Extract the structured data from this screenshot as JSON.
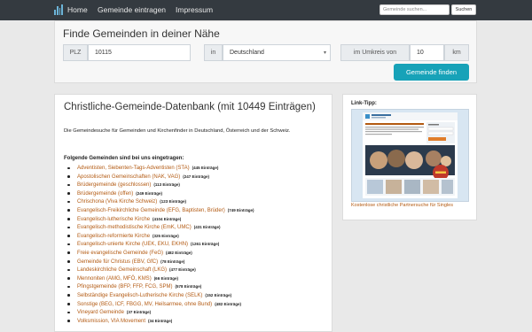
{
  "nav": {
    "home": "Home",
    "add": "Gemeinde eintragen",
    "impressum": "Impressum",
    "search_placeholder": "Gemeinde suchen...",
    "search_button": "Suchen"
  },
  "search": {
    "title": "Finde Gemeinden in deiner Nähe",
    "plz_label": "PLZ",
    "plz_value": "10115",
    "in_label": "in",
    "country_value": "Deutschland",
    "radius_label": "im Umkreis von",
    "radius_value": "10",
    "unit_label": "km",
    "submit_label": "Gemeinde finden"
  },
  "main": {
    "title": "Christliche-Gemeinde-Datenbank (mit 10449 Einträgen)",
    "description": "Die Gemeindesuche für Gemeinden und Kirchenfinder in Deutschland, Österreich und der Schweiz.",
    "list_heading": "Folgende Gemeinden sind bei uns eingetragen:",
    "items": [
      {
        "name": "Adventisten, Siebenten-Tags-Adventisten (STA)",
        "count": "(445 Einträge)"
      },
      {
        "name": "Apostolischen Gemeinschaften (NAK, VAG)",
        "count": "(247 Einträge)"
      },
      {
        "name": "Brüdergemeinde (geschlossen)",
        "count": "(113 Einträge)"
      },
      {
        "name": "Brüdergemeinde (offen)",
        "count": "(249 Einträge)"
      },
      {
        "name": "Chrischona (Viva Kirche Schweiz)",
        "count": "(123 Einträge)"
      },
      {
        "name": "Evangelisch-Freikirchliche Gemeinde (EFG, Baptisten, Brüder)",
        "count": "(749 Einträge)"
      },
      {
        "name": "Evangelisch-lutherische Kirche",
        "count": "(4104 Einträge)"
      },
      {
        "name": "Evangelisch-methodistische Kirche (EmK, UMC)",
        "count": "(431 Einträge)"
      },
      {
        "name": "Evangelisch-reformierte Kirche",
        "count": "(325 Einträge)"
      },
      {
        "name": "Evangelisch-unierte Kirche (UEK, EKU, EKHN)",
        "count": "(1261 Einträge)"
      },
      {
        "name": "Freie evangelische Gemeinde (FeG)",
        "count": "(482 Einträge)"
      },
      {
        "name": "Gemeinde für Christus (EBV, GfC)",
        "count": "(78 Einträge)"
      },
      {
        "name": "Landeskirchliche Gemeinschaft (LKG)",
        "count": "(477 Einträge)"
      },
      {
        "name": "Mennoniten (AMG, MFÖ, KMS)",
        "count": "(66 Einträge)"
      },
      {
        "name": "Pfingstgemeinde (BFP, FFP, FCG, SPM)",
        "count": "(578 Einträge)"
      },
      {
        "name": "Selbständige Evangelisch-Lutherische Kirche (SELK)",
        "count": "(152 Einträge)"
      },
      {
        "name": "Sonstige (BEG, ICF, FBGG, MV, Heilsarmee, ohne Bund)",
        "count": "(482 Einträge)"
      },
      {
        "name": "Vineyard Gemeinde",
        "count": "(37 Einträge)"
      },
      {
        "name": "Volksmission, VIA Movement",
        "count": "(34 Einträge)"
      }
    ]
  },
  "sidebar": {
    "title": "Link-Tipp:",
    "promo_brand": "CHRISTLICHE PARTNERSUCHE",
    "promo_link": "Kostenlose christliche Partnersuche für Singles"
  },
  "colors": {
    "navbar": "#343a40",
    "link": "#b35a12",
    "accent": "#17a2b8"
  }
}
